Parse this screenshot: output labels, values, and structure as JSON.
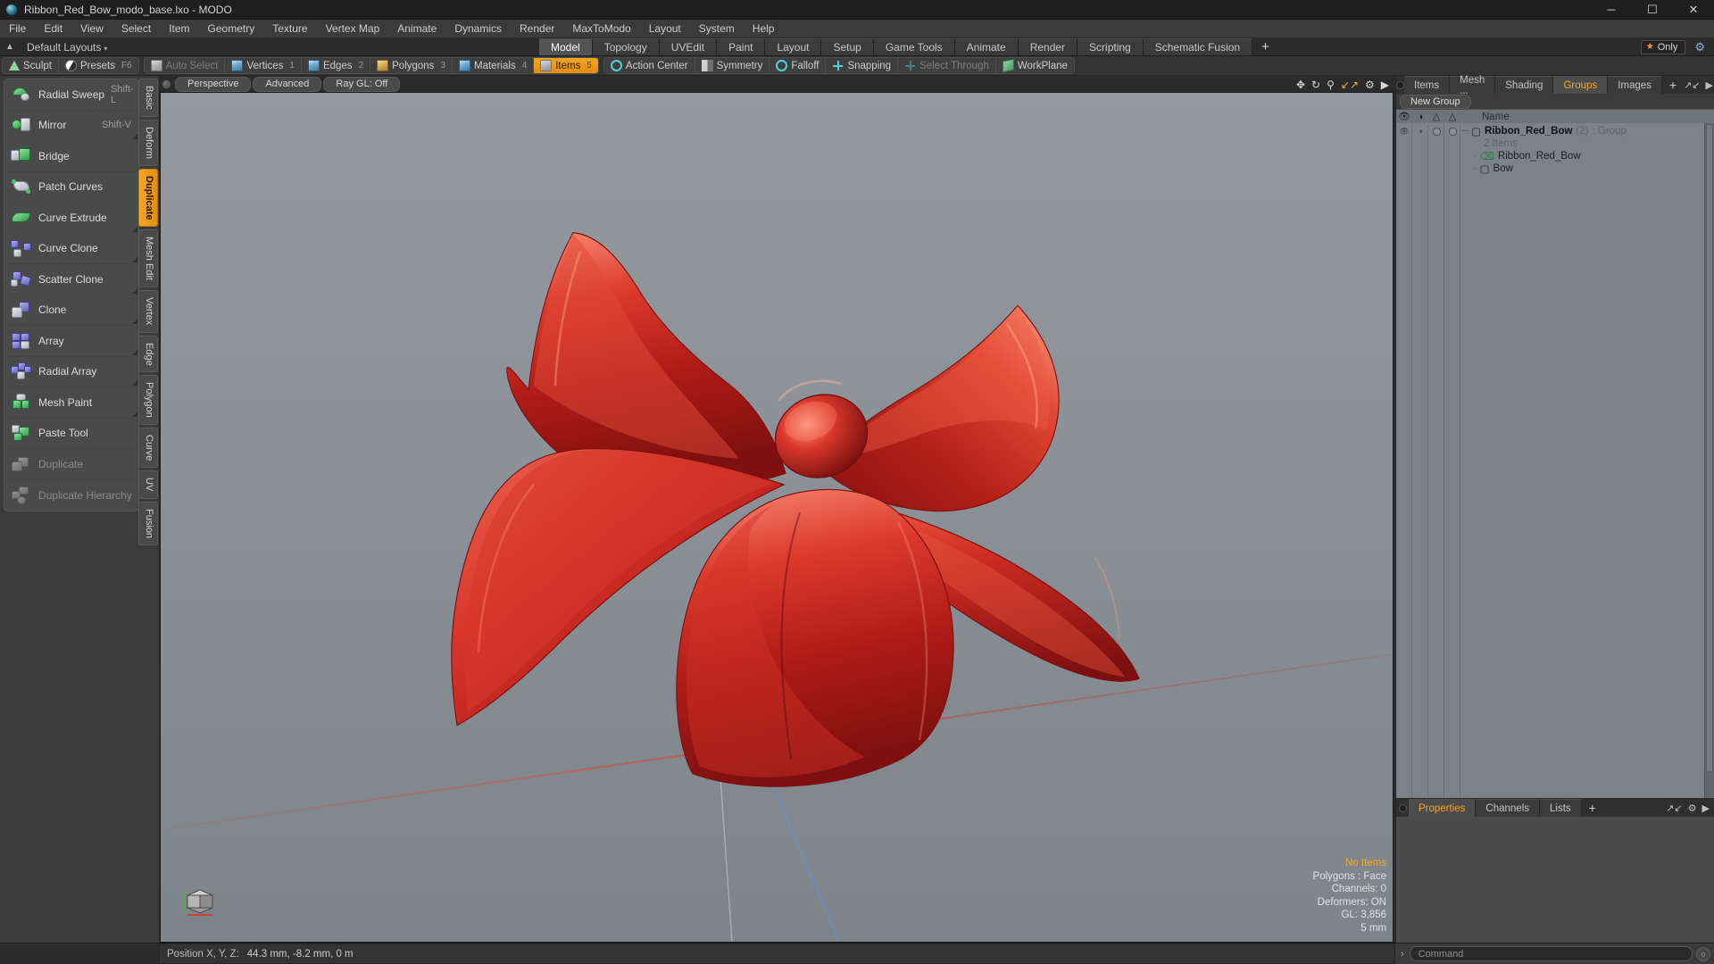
{
  "window": {
    "title": "Ribbon_Red_Bow_modo_base.lxo - MODO",
    "app_icon": "modo-sphere-icon",
    "minimize": "─",
    "maximize": "☐",
    "close": "✕"
  },
  "menubar": {
    "items": [
      "File",
      "Edit",
      "View",
      "Select",
      "Item",
      "Geometry",
      "Texture",
      "Vertex Map",
      "Animate",
      "Dynamics",
      "Render",
      "MaxToModo",
      "Layout",
      "System",
      "Help"
    ]
  },
  "layoutbar": {
    "home_icon": "home-arrow-icon",
    "label": "Default Layouts",
    "caret": "▾",
    "tabs": [
      {
        "label": "Model",
        "active": true
      },
      {
        "label": "Topology",
        "active": false
      },
      {
        "label": "UVEdit",
        "active": false
      },
      {
        "label": "Paint",
        "active": false
      },
      {
        "label": "Layout",
        "active": false
      },
      {
        "label": "Setup",
        "active": false
      },
      {
        "label": "Game Tools",
        "active": false
      },
      {
        "label": "Animate",
        "active": false
      },
      {
        "label": "Render",
        "active": false
      },
      {
        "label": "Scripting",
        "active": false
      },
      {
        "label": "Schematic Fusion",
        "active": false
      }
    ],
    "add_tab": "+",
    "only_badge": {
      "star": "★",
      "label": "Only"
    },
    "gear": "⚙"
  },
  "modebar": {
    "groups": [
      {
        "items": [
          {
            "label": "Sculpt",
            "icon": "sculpt-brush-icon",
            "state": "normal",
            "num": ""
          },
          {
            "label": "Presets",
            "icon": "presets-sphere-icon",
            "state": "normal",
            "num": "F6"
          }
        ]
      },
      {
        "items": [
          {
            "label": "Auto Select",
            "icon": "auto-select-cube-icon",
            "state": "disabled",
            "num": ""
          },
          {
            "label": "Vertices",
            "icon": "vertices-cube-icon",
            "state": "normal",
            "num": "1"
          },
          {
            "label": "Edges",
            "icon": "edges-cube-icon",
            "state": "normal",
            "num": "2"
          },
          {
            "label": "Polygons",
            "icon": "polygons-cube-icon",
            "state": "normal",
            "num": "3"
          },
          {
            "label": "Materials",
            "icon": "materials-cube-icon",
            "state": "normal",
            "num": "4"
          },
          {
            "label": "Items",
            "icon": "items-cube-icon",
            "state": "active",
            "num": "5"
          }
        ]
      },
      {
        "items": [
          {
            "label": "Action Center",
            "icon": "action-center-icon",
            "state": "normal",
            "num": ""
          },
          {
            "label": "Symmetry",
            "icon": "symmetry-icon",
            "state": "normal",
            "num": ""
          },
          {
            "label": "Falloff",
            "icon": "falloff-icon",
            "state": "normal",
            "num": ""
          },
          {
            "label": "Snapping",
            "icon": "snapping-icon",
            "state": "normal",
            "num": ""
          },
          {
            "label": "Select Through",
            "icon": "select-through-icon",
            "state": "disabled",
            "num": ""
          },
          {
            "label": "WorkPlane",
            "icon": "workplane-icon",
            "state": "normal",
            "num": ""
          }
        ]
      }
    ]
  },
  "left_panel": {
    "tools": [
      {
        "label": "Radial Sweep",
        "shortcut": "Shift-L",
        "icon": "radial-sweep-icon",
        "disabled": false,
        "submenu": false
      },
      {
        "label": "Mirror",
        "shortcut": "Shift-V",
        "icon": "mirror-icon",
        "disabled": false,
        "submenu": true
      },
      {
        "label": "Bridge",
        "shortcut": "",
        "icon": "bridge-icon",
        "disabled": false,
        "submenu": false
      },
      {
        "label": "Patch Curves",
        "shortcut": "",
        "icon": "patch-curves-icon",
        "disabled": false,
        "submenu": false
      },
      {
        "label": "Curve Extrude",
        "shortcut": "",
        "icon": "curve-extrude-icon",
        "disabled": false,
        "submenu": true
      },
      {
        "label": "Curve Clone",
        "shortcut": "",
        "icon": "curve-clone-icon",
        "disabled": false,
        "submenu": true
      },
      {
        "label": "Scatter Clone",
        "shortcut": "",
        "icon": "scatter-clone-icon",
        "disabled": false,
        "submenu": true
      },
      {
        "label": "Clone",
        "shortcut": "",
        "icon": "clone-icon",
        "disabled": false,
        "submenu": true
      },
      {
        "label": "Array",
        "shortcut": "",
        "icon": "array-icon",
        "disabled": false,
        "submenu": true
      },
      {
        "label": "Radial Array",
        "shortcut": "",
        "icon": "radial-array-icon",
        "disabled": false,
        "submenu": true
      },
      {
        "label": "Mesh Paint",
        "shortcut": "",
        "icon": "mesh-paint-icon",
        "disabled": false,
        "submenu": true
      },
      {
        "label": "Paste Tool",
        "shortcut": "",
        "icon": "paste-tool-icon",
        "disabled": false,
        "submenu": false
      },
      {
        "label": "Duplicate",
        "shortcut": "",
        "icon": "duplicate-icon",
        "disabled": true,
        "submenu": false
      },
      {
        "label": "Duplicate Hierarchy",
        "shortcut": "",
        "icon": "duplicate-hierarchy-icon",
        "disabled": true,
        "submenu": false
      }
    ],
    "vtabs": [
      {
        "label": "Basic",
        "active": false
      },
      {
        "label": "Deform",
        "active": false
      },
      {
        "label": "Duplicate",
        "active": true
      },
      {
        "label": "Mesh Edit",
        "active": false
      },
      {
        "label": "Vertex",
        "active": false
      },
      {
        "label": "Edge",
        "active": false
      },
      {
        "label": "Polygon",
        "active": false
      },
      {
        "label": "Curve",
        "active": false
      },
      {
        "label": "UV",
        "active": false
      },
      {
        "label": "Fusion",
        "active": false
      }
    ]
  },
  "viewport": {
    "buttons": [
      "Perspective",
      "Advanced",
      "Ray GL: Off"
    ],
    "tools": [
      "move-icon",
      "rotate-icon",
      "zoom-icon",
      "fit-icon",
      "gear-icon",
      "expand-arrow-icon"
    ],
    "stats": {
      "items": "No Items",
      "polygons": "Polygons : Face",
      "channels": "Channels: 0",
      "deformers": "Deformers: ON",
      "gl": "GL: 3,856",
      "scale": "5 mm"
    },
    "model": "red-ribbon-bow-3d-model"
  },
  "right_panel": {
    "tabs": [
      {
        "label": "Items",
        "active": false
      },
      {
        "label": "Mesh ...",
        "active": false
      },
      {
        "label": "Shading",
        "active": false
      },
      {
        "label": "Groups",
        "active": true
      },
      {
        "label": "Images",
        "active": false
      }
    ],
    "add_tab": "+",
    "new_group_button": "New Group",
    "tree_header": {
      "col_eye": "visibility-eye-icon",
      "col_render": "render-icon",
      "col_lock": "lock-icon",
      "col_select": "select-icon",
      "name": "Name"
    },
    "tree_rows": [
      {
        "indent": 0,
        "label": "Ribbon_Red_Bow",
        "suffix": "(2)",
        "type": ": Group",
        "icon": "group-cube-icon",
        "bold": true
      },
      {
        "indent": 1,
        "label": "2 Items",
        "suffix": "",
        "type": "",
        "icon": "",
        "bold": false
      },
      {
        "indent": 1,
        "label": "Ribbon_Red_Bow",
        "suffix": "",
        "type": "",
        "icon": "locator-axis-icon",
        "bold": false
      },
      {
        "indent": 1,
        "label": "Bow",
        "suffix": "",
        "type": "",
        "icon": "mesh-cube-icon",
        "bold": false
      }
    ],
    "bottom_tabs": [
      {
        "label": "Properties",
        "active": true
      },
      {
        "label": "Channels",
        "active": false
      },
      {
        "label": "Lists",
        "active": false
      }
    ],
    "bottom_add_tab": "+"
  },
  "statusbar": {
    "position_label": "Position X, Y, Z:",
    "position_value": "44.3 mm,  -8.2 mm, 0 m",
    "command_chevron": "›",
    "command_placeholder": "Command",
    "command_run": "○"
  }
}
